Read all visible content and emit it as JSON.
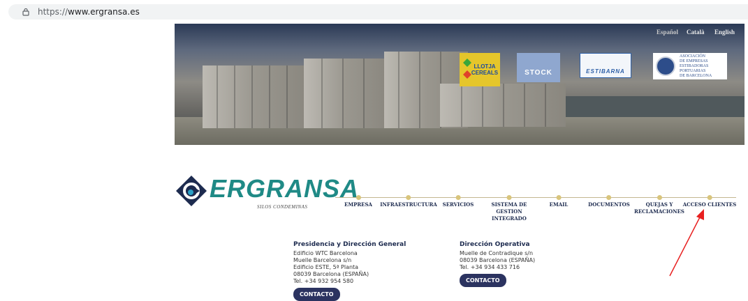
{
  "browser": {
    "url_protocol": "https://",
    "url_host": "www.ergransa.es",
    "lock_icon": "lock-icon"
  },
  "banner": {
    "languages": [
      "Español",
      "Català",
      "English"
    ],
    "logos": {
      "lloтja": "LLOTJA CEREALS",
      "stock": "STOCK",
      "estibarna": "ESTIBARNA",
      "asociacion": [
        "ASOCIACIÓN",
        "DE EMPRESAS",
        "ESTIBADORAS",
        "PORTUARIAS",
        "DE BARCELONA"
      ]
    }
  },
  "brand": {
    "name": "ERGRANSA",
    "subtitle": "SILOS CONDEMINAS",
    "color": "#1f8a86"
  },
  "nav": [
    {
      "label": "EMPRESA"
    },
    {
      "label": "INFRAESTRUCTURA"
    },
    {
      "label": "SERVICIOS"
    },
    {
      "label": "SISTEMA DE\nGESTION\nINTEGRADO"
    },
    {
      "label": "EMAIL"
    },
    {
      "label": "DOCUMENTOS"
    },
    {
      "label": "QUEJAS Y\nRECLAMACIONES"
    },
    {
      "label": "ACCESO CLIENTES"
    }
  ],
  "contacts": [
    {
      "title": "Presidencia y Dirección General",
      "lines": [
        "Edificio WTC Barcelona",
        "Muelle Barcelona s/n",
        "Edificio ESTE, 5ª Planta",
        "08039 Barcelona (ESPAÑA)",
        "Tel. +34 932 954 580"
      ],
      "button": "CONTACTO"
    },
    {
      "title": "Dirección Operativa",
      "lines": [
        "Muelle de Contradique s/n",
        "08039 Barcelona (ESPAÑA)",
        "Tel. +34 934 433 716"
      ],
      "button": "CONTACTO"
    }
  ],
  "annotation": {
    "arrow_color": "#e82020"
  }
}
